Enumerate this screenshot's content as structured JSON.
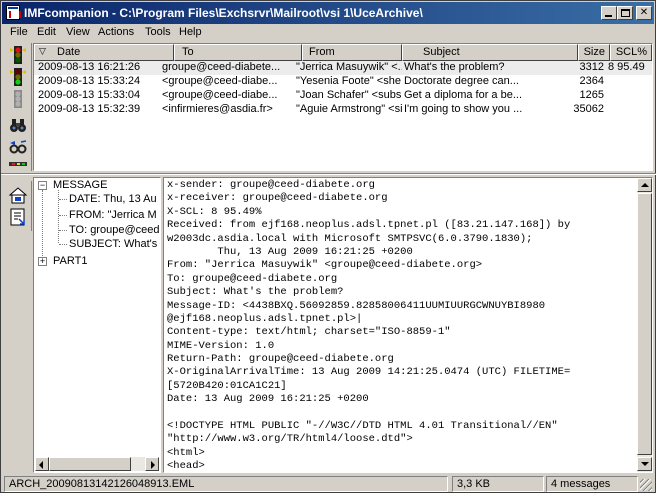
{
  "window": {
    "title": "IMFcompanion - C:\\Program Files\\Exchsrvr\\Mailroot\\vsi 1\\UceArchive\\",
    "accent_color": "#0a246a"
  },
  "menu": [
    {
      "label": "File"
    },
    {
      "label": "Edit"
    },
    {
      "label": "View"
    },
    {
      "label": "Actions"
    },
    {
      "label": "Tools"
    },
    {
      "label": "Help"
    }
  ],
  "toolbar_top": [
    {
      "icon": "traffic-light-red-icon"
    },
    {
      "icon": "traffic-light-green-icon"
    },
    {
      "icon": "traffic-light-gray-icon"
    },
    {
      "icon": "binoculars-icon"
    },
    {
      "icon": "find-next-icon"
    },
    {
      "icon": "options-icon"
    }
  ],
  "toolbar_bottom": [
    {
      "icon": "save-icon"
    },
    {
      "icon": "export-icon"
    }
  ],
  "list": {
    "columns": [
      "Date",
      "To",
      "From",
      "Subject",
      "Size",
      "SCL%"
    ],
    "rows": [
      {
        "date": "2009-08-13 16:21:26",
        "to": "groupe@ceed-diabete...",
        "from": "\"Jerrica Masuywik\" <...",
        "subject": "What's the problem?",
        "size": "3312",
        "scl": "8 95.49"
      },
      {
        "date": "2009-08-13 15:33:24",
        "to": "<groupe@ceed-diabe...",
        "from": "\"Yesenia Foote\" <she...",
        "subject": "Doctorate degree can...",
        "size": "2364",
        "scl": ""
      },
      {
        "date": "2009-08-13 15:33:04",
        "to": "<groupe@ceed-diabe...",
        "from": "\"Joan Schafer\" <subs...",
        "subject": "Get a diploma for a be...",
        "size": "1265",
        "scl": ""
      },
      {
        "date": "2009-08-13 15:32:39",
        "to": "<infirmieres@asdia.fr>",
        "from": "\"Aguie Armstrong\" <si...",
        "subject": "I'm going to show you ...",
        "size": "35062",
        "scl": ""
      }
    ]
  },
  "tree": {
    "root": "MESSAGE",
    "children": [
      "DATE: Thu, 13 Au",
      "FROM: \"Jerrica M",
      "TO: groupe@ceed",
      "SUBJECT: What's"
    ],
    "part": "PART1"
  },
  "text_lines": [
    "x-sender: groupe@ceed-diabete.org",
    "x-receiver: groupe@ceed-diabete.org",
    "X-SCL: 8 95.49%",
    "Received: from ejf168.neoplus.adsl.tpnet.pl ([83.21.147.168]) by",
    "w2003dc.asdia.local with Microsoft SMTPSVC(6.0.3790.1830);",
    "        Thu, 13 Aug 2009 16:21:25 +0200",
    "From: \"Jerrica Masuywik\" <groupe@ceed-diabete.org>",
    "To: groupe@ceed-diabete.org",
    "Subject: What's the problem?",
    "Message-ID: <4438BXQ.56092859.82858006411UUMIUURGCWNUYBI8980",
    "@ejf168.neoplus.adsl.tpnet.pl>|",
    "Content-type: text/html; charset=\"ISO-8859-1\"",
    "MIME-Version: 1.0",
    "Return-Path: groupe@ceed-diabete.org",
    "X-OriginalArrivalTime: 13 Aug 2009 14:21:25.0474 (UTC) FILETIME=",
    "[5720B420:01CA1C21]",
    "Date: 13 Aug 2009 16:21:25 +0200",
    "",
    "<!DOCTYPE HTML PUBLIC \"-//W3C//DTD HTML 4.01 Transitional//EN\"",
    "\"http://www.w3.org/TR/html4/loose.dtd\">",
    "<html>",
    "<head>"
  ],
  "status": {
    "file": "ARCH_20090813142126048913.EML",
    "size": "3,3 KB",
    "count": "4 messages"
  }
}
